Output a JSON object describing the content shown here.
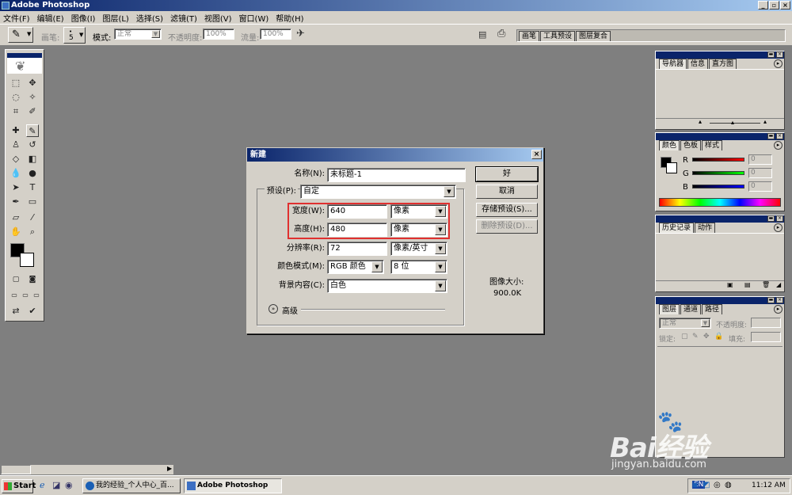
{
  "window": {
    "title": "Adobe Photoshop"
  },
  "menu": [
    "文件(F)",
    "编辑(E)",
    "图像(I)",
    "图层(L)",
    "选择(S)",
    "滤镜(T)",
    "视图(V)",
    "窗口(W)",
    "帮助(H)"
  ],
  "options": {
    "brush_label": "画笔:",
    "brush_size": "5",
    "mode_label": "模式:",
    "mode_value": "正常",
    "opacity_label": "不透明度:",
    "opacity_value": "100%",
    "flow_label": "流量:",
    "flow_value": "100%",
    "well_tabs": [
      "画笔",
      "工具预设",
      "图层复合"
    ]
  },
  "dialog": {
    "title": "新建",
    "name_label": "名称(N):",
    "name_value": "未标题-1",
    "preset_label": "预设(P):",
    "preset_value": "自定",
    "width_label": "宽度(W):",
    "width_value": "640",
    "width_unit": "像素",
    "height_label": "高度(H):",
    "height_value": "480",
    "height_unit": "像素",
    "resolution_label": "分辨率(R):",
    "resolution_value": "72",
    "resolution_unit": "像素/英寸",
    "colormode_label": "颜色模式(M):",
    "colormode_value": "RGB 颜色",
    "bitdepth_value": "8 位",
    "background_label": "背景内容(C):",
    "background_value": "白色",
    "advanced_label": "高级",
    "ok_label": "好",
    "cancel_label": "取消",
    "save_preset_label": "存储预设(S)...",
    "delete_preset_label": "删除预设(D)...",
    "image_size_label": "图像大小:",
    "image_size_value": "900.0K"
  },
  "panels": {
    "navigator_tabs": [
      "导航器",
      "信息",
      "直方图"
    ],
    "color_tabs": [
      "颜色",
      "色板",
      "样式"
    ],
    "color_channels": [
      {
        "label": "R",
        "value": "0"
      },
      {
        "label": "G",
        "value": "0"
      },
      {
        "label": "B",
        "value": "0"
      }
    ],
    "history_tabs": [
      "历史记录",
      "动作"
    ],
    "layers_tabs": [
      "图层",
      "通道",
      "路径"
    ],
    "layers_mode": "正常",
    "layers_opacity_label": "不透明度:",
    "layers_lock_label": "锁定:",
    "layers_fill_label": "填充:"
  },
  "taskbar": {
    "start_label": "Start",
    "tasks": [
      "我的经验_个人中心_百...",
      "Adobe Photoshop"
    ],
    "lang": "EN",
    "clock": "11:12 AM"
  },
  "watermark": {
    "brand": "Bai经验",
    "url": "jingyan.baidu.com"
  },
  "colors": {
    "accent": "#0a246a",
    "highlight_box": "#e03030"
  }
}
